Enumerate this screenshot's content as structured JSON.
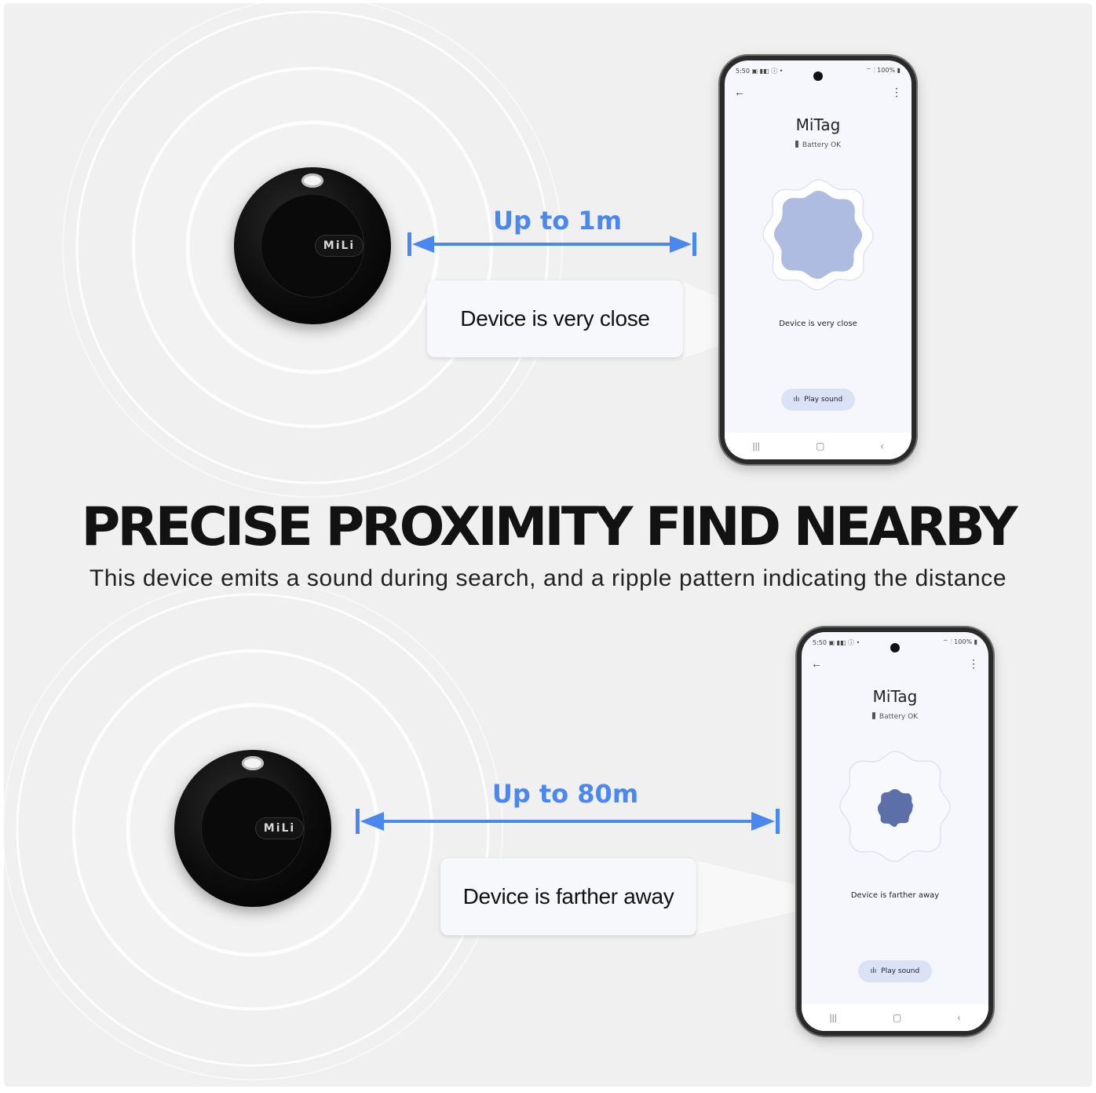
{
  "headline": "PRECISE PROXIMITY FIND NEARBY",
  "subline": "This device emits a sound during search, and a ripple pattern indicating the distance",
  "accent_color": "#4a87ee",
  "tag_brand": "MiLi",
  "near": {
    "range_label": "Up to 1m",
    "callout": "Device is very close",
    "phone": {
      "time": "5:50",
      "status_icons_left": "▣ ▮◧ ⓘ •",
      "status_right": "100%",
      "back_icon": "back-arrow-icon",
      "menu_icon": "more-vert-icon",
      "app_title": "MiTag",
      "battery": "Battery OK",
      "status_text": "Device is very close",
      "play_label": "Play sound",
      "proximity_level": "large"
    }
  },
  "far": {
    "range_label": "Up to 80m",
    "callout": "Device is farther away",
    "phone": {
      "time": "5:50",
      "status_icons_left": "▣ ▮◧ ⓘ •",
      "status_right": "100%",
      "back_icon": "back-arrow-icon",
      "menu_icon": "more-vert-icon",
      "app_title": "MiTag",
      "battery": "Battery OK",
      "status_text": "Device is farther away",
      "play_label": "Play sound",
      "proximity_level": "small"
    }
  }
}
